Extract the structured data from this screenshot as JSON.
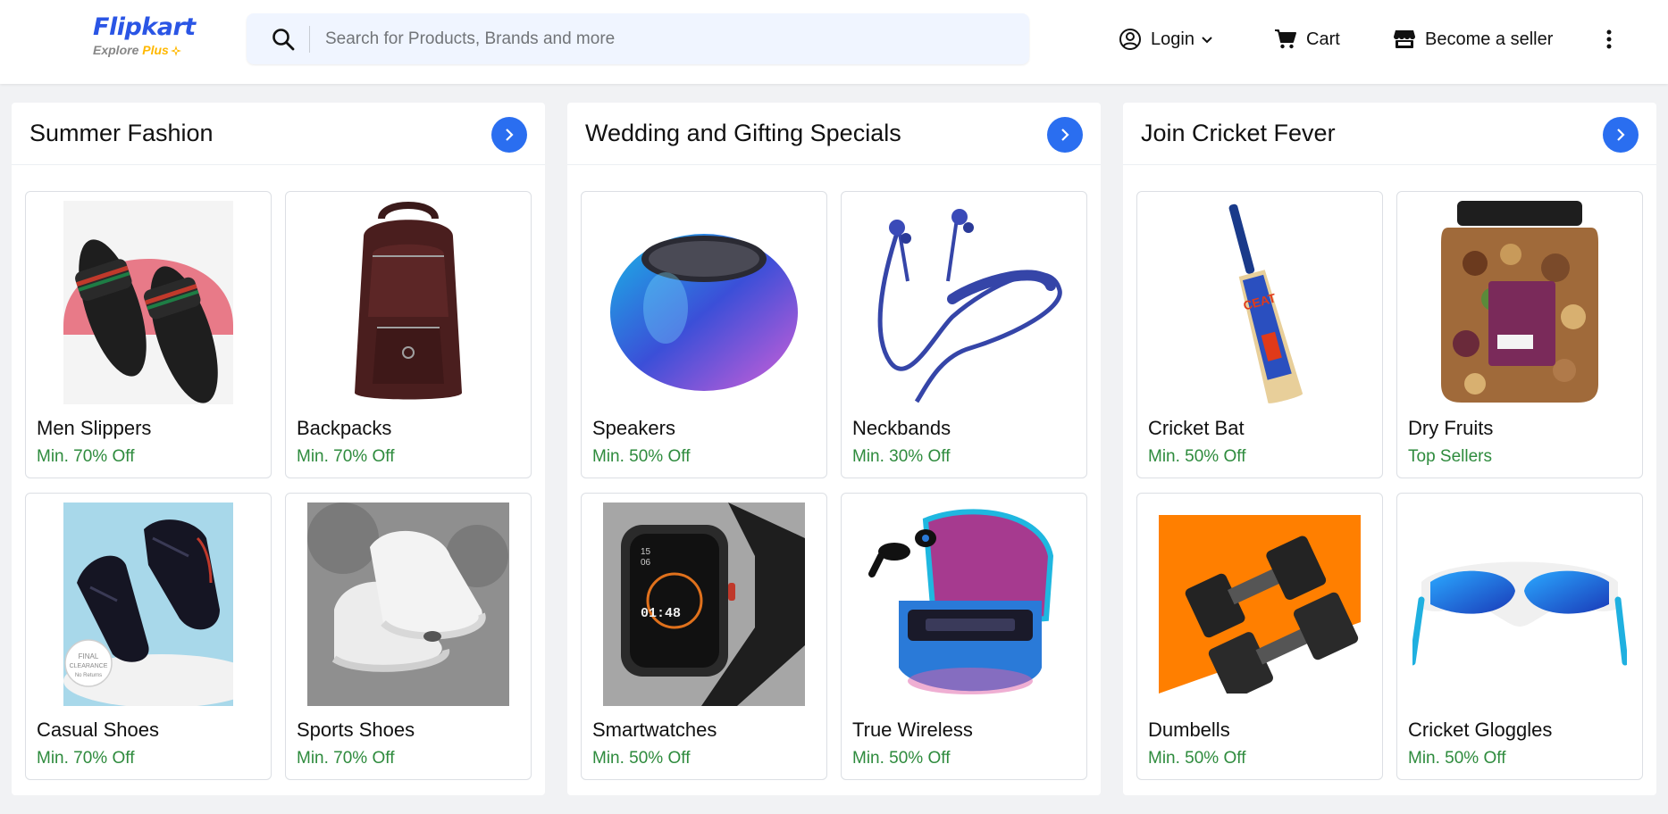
{
  "header": {
    "logo": {
      "brand": "Flipkart",
      "sub_prefix": "Explore ",
      "sub_plus": "Plus"
    },
    "search": {
      "placeholder": "Search for Products, Brands and more",
      "value": ""
    },
    "nav": {
      "login": "Login",
      "cart": "Cart",
      "seller": "Become a seller"
    }
  },
  "colors": {
    "brand_blue": "#2a55e5",
    "accent_blue": "#2a6ef0",
    "offer_green": "#2e8b3d",
    "plus_yellow": "#ffb800"
  },
  "sections": [
    {
      "title": "Summer Fashion",
      "items": [
        {
          "name": "Men Slippers",
          "offer": "Min. 70% Off",
          "icon": "slippers-image"
        },
        {
          "name": "Backpacks",
          "offer": "Min. 70% Off",
          "icon": "backpack-image"
        },
        {
          "name": "Casual Shoes",
          "offer": "Min. 70% Off",
          "icon": "casual-shoes-image",
          "badge": [
            "FINAL",
            "CLEARANCE",
            "No Returns"
          ]
        },
        {
          "name": "Sports Shoes",
          "offer": "Min. 70% Off",
          "icon": "sports-shoes-image"
        }
      ]
    },
    {
      "title": "Wedding and Gifting Specials",
      "items": [
        {
          "name": "Speakers",
          "offer": "Min. 50% Off",
          "icon": "speaker-image"
        },
        {
          "name": "Neckbands",
          "offer": "Min. 30% Off",
          "icon": "neckband-image"
        },
        {
          "name": "Smartwatches",
          "offer": "Min. 50% Off",
          "icon": "smartwatch-image",
          "screen": [
            "01:48",
            "15",
            "06"
          ]
        },
        {
          "name": "True Wireless",
          "offer": "Min. 50% Off",
          "icon": "earbuds-image"
        }
      ]
    },
    {
      "title": "Join Cricket Fever",
      "items": [
        {
          "name": "Cricket Bat",
          "offer": "Min. 50% Off",
          "icon": "cricket-bat-image",
          "bat_brand": "CEAT"
        },
        {
          "name": "Dry Fruits",
          "offer": "Top Sellers",
          "icon": "dry-fruits-image"
        },
        {
          "name": "Dumbells",
          "offer": "Min. 50% Off",
          "icon": "dumbbells-image"
        },
        {
          "name": "Cricket Gloggles",
          "offer": "Min. 50% Off",
          "icon": "sunglasses-image"
        }
      ]
    }
  ]
}
